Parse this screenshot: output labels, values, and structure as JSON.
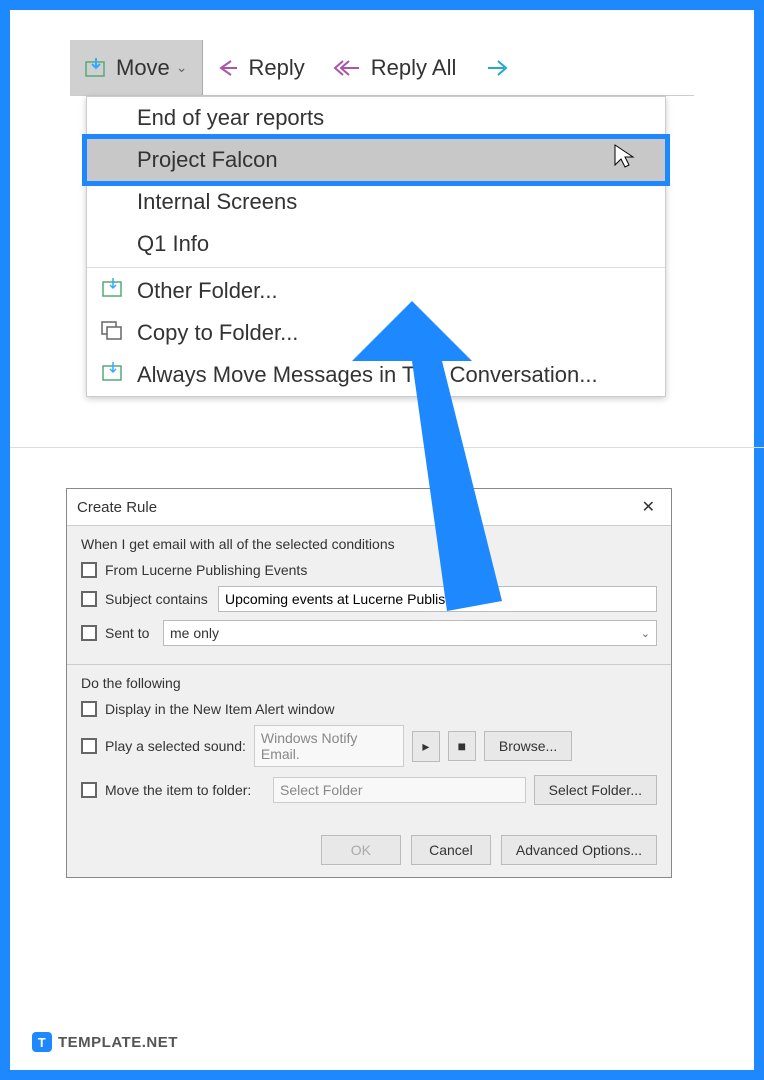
{
  "toolbar": {
    "move_label": "Move",
    "reply_label": "Reply",
    "reply_all_label": "Reply All"
  },
  "menu": {
    "items": [
      "End of year reports",
      "Project Falcon",
      "Internal Screens",
      "Q1 Info"
    ],
    "other_folder": "Other Folder...",
    "copy_to_folder": "Copy to Folder...",
    "always_move": "Always Move Messages in This Conversation..."
  },
  "dialog": {
    "title": "Create Rule",
    "section1_label": "When I get email with all of the selected conditions",
    "from_label": "From Lucerne Publishing Events",
    "subject_label": "Subject contains",
    "subject_value": "Upcoming events at Lucerne Publishing",
    "sent_to_label": "Sent to",
    "sent_to_value": "me only",
    "section2_label": "Do the following",
    "display_alert_label": "Display in the New Item Alert window",
    "play_sound_label": "Play a selected sound:",
    "sound_value": "Windows Notify Email.",
    "browse_label": "Browse...",
    "move_item_label": "Move the item to folder:",
    "select_folder_placeholder": "Select Folder",
    "select_folder_button": "Select Folder...",
    "ok_label": "OK",
    "cancel_label": "Cancel",
    "advanced_label": "Advanced Options..."
  },
  "footer": {
    "brand": "TEMPLATE.NET"
  },
  "colors": {
    "accent": "#1e88ff"
  }
}
